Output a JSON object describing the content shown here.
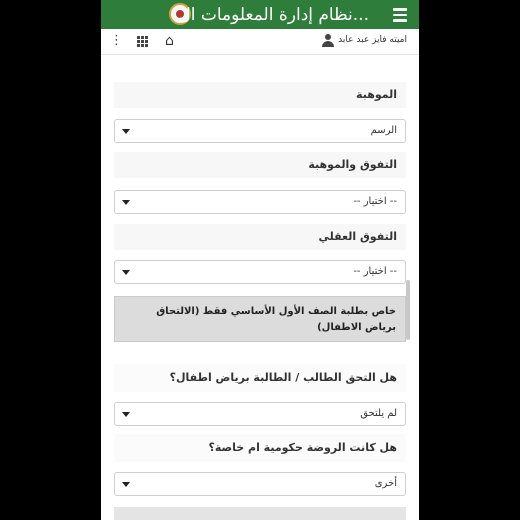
{
  "app": {
    "title": "...نظام إدارة المعلومات ال",
    "user_name": "اميته فايز عبد عابد"
  },
  "icons": {
    "menu": "hamburger-icon",
    "more": "more-vert-icon",
    "apps": "apps-grid-icon",
    "home": "home-icon",
    "user": "user-icon"
  },
  "colors": {
    "header_bg": "#2f7d3b",
    "notice_bg": "#dcdcdc"
  },
  "form": {
    "talent_label": "الموهبة",
    "talent_value": "الرسم",
    "excellence_label": "التفوق والموهبة",
    "excellence_value": "-- اختيار --",
    "mental_label": "التفوق العقلي",
    "mental_value": "-- اختيار --",
    "notice": "خاص بطلبة الصف الأول الأساسي فقط (الالتحاق برياض الاطفال)",
    "kg_label": "هل التحق الطالب / الطالبة برياض اطفال؟",
    "kg_value": "لم يلتحق",
    "kg_type_label": "هل كانت الروضة حكومية ام خاصة؟",
    "kg_type_value": "أخرى"
  }
}
